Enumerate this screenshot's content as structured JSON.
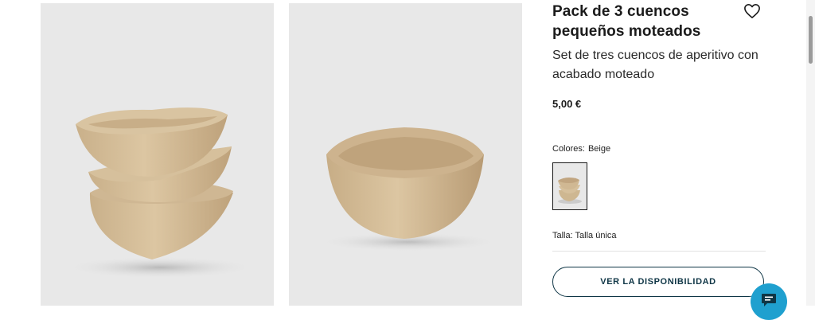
{
  "product": {
    "title": "Pack de 3 cuencos pequeños moteados",
    "subtitle": "Set de tres cuencos de aperitivo con acabado moteado",
    "price": "5,00 €",
    "colors_label": "Colores:",
    "color_value": "Beige",
    "size_label": "Talla:",
    "size_value": "Talla única",
    "availability_button": "VER LA DISPONIBILIDAD"
  },
  "icons": {
    "favorite": "heart-icon",
    "chat": "chat-icon"
  },
  "colors": {
    "accent": "#0f3646",
    "chat": "#1fa0cf",
    "image_bg": "#e8e8e8",
    "bowl": "#d5bf9a"
  }
}
